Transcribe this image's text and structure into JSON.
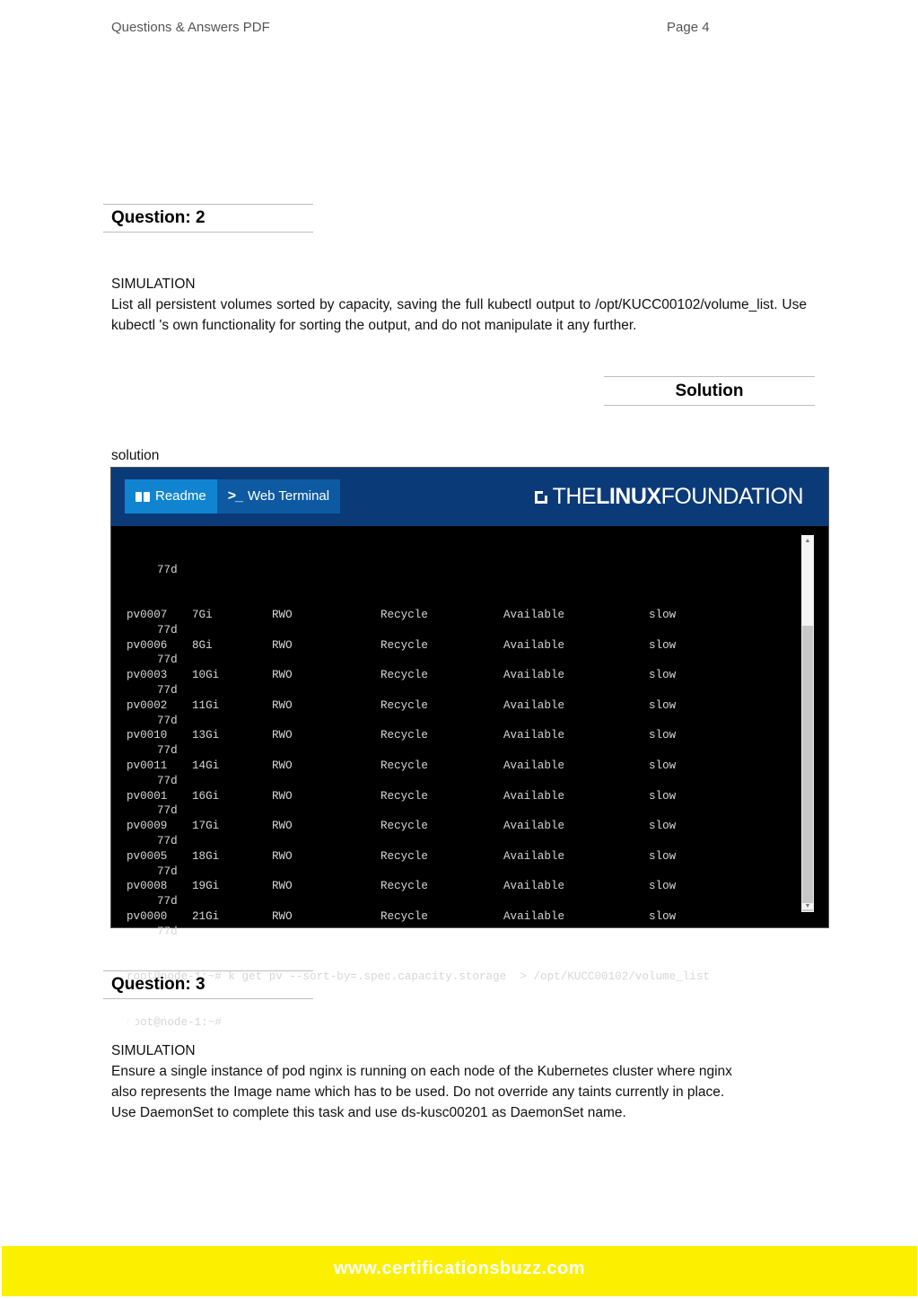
{
  "header": {
    "title": "Questions & Answers PDF",
    "page": "Page 4"
  },
  "question2": {
    "heading": "Question: 2",
    "type": "SIMULATION",
    "lines": [
      "List all persistent volumes sorted by capacity, saving the full kubectl output to",
      "/opt/KUCC00102/volume_list. Use kubectl 's own functionality for sorting the output, and do not",
      "manipulate it any further."
    ]
  },
  "solution": {
    "heading": "Solution",
    "label": "solution"
  },
  "terminal": {
    "tabs": [
      {
        "label": "Readme",
        "icon": "book-icon"
      },
      {
        "label": "Web Terminal",
        "icon": "terminal-prompt-icon"
      }
    ],
    "logo": {
      "prefix": "THE",
      "bold": "LINUX",
      "suffix": "FOUNDATION"
    },
    "first_age": "77d",
    "rows": [
      {
        "name": "pv0007",
        "capacity": "7Gi",
        "access": "RWO",
        "policy": "Recycle",
        "status": "Available",
        "class": "slow",
        "age": "77d"
      },
      {
        "name": "pv0006",
        "capacity": "8Gi",
        "access": "RWO",
        "policy": "Recycle",
        "status": "Available",
        "class": "slow",
        "age": "77d"
      },
      {
        "name": "pv0003",
        "capacity": "10Gi",
        "access": "RWO",
        "policy": "Recycle",
        "status": "Available",
        "class": "slow",
        "age": "77d"
      },
      {
        "name": "pv0002",
        "capacity": "11Gi",
        "access": "RWO",
        "policy": "Recycle",
        "status": "Available",
        "class": "slow",
        "age": "77d"
      },
      {
        "name": "pv0010",
        "capacity": "13Gi",
        "access": "RWO",
        "policy": "Recycle",
        "status": "Available",
        "class": "slow",
        "age": "77d"
      },
      {
        "name": "pv0011",
        "capacity": "14Gi",
        "access": "RWO",
        "policy": "Recycle",
        "status": "Available",
        "class": "slow",
        "age": "77d"
      },
      {
        "name": "pv0001",
        "capacity": "16Gi",
        "access": "RWO",
        "policy": "Recycle",
        "status": "Available",
        "class": "slow",
        "age": "77d"
      },
      {
        "name": "pv0009",
        "capacity": "17Gi",
        "access": "RWO",
        "policy": "Recycle",
        "status": "Available",
        "class": "slow",
        "age": "77d"
      },
      {
        "name": "pv0005",
        "capacity": "18Gi",
        "access": "RWO",
        "policy": "Recycle",
        "status": "Available",
        "class": "slow",
        "age": "77d"
      },
      {
        "name": "pv0008",
        "capacity": "19Gi",
        "access": "RWO",
        "policy": "Recycle",
        "status": "Available",
        "class": "slow",
        "age": "77d"
      },
      {
        "name": "pv0000",
        "capacity": "21Gi",
        "access": "RWO",
        "policy": "Recycle",
        "status": "Available",
        "class": "slow",
        "age": "77d"
      }
    ],
    "command_line": "root@node-1:~# k get pv --sort-by=.spec.capacity.storage  > /opt/KUCC00102/volume_list",
    "prompt_line": "root@node-1:~# "
  },
  "question3": {
    "heading": "Question: 3",
    "type": "SIMULATION",
    "lines": [
      "Ensure a single instance of pod nginx is running on each node of the Kubernetes cluster where nginx",
      "also represents the Image name which has to be used. Do not override any taints currently in place.",
      "Use DaemonSet to complete this task and use ds-kusc00201 as DaemonSet name."
    ]
  },
  "footer": {
    "url": "www.certificationsbuzz.com"
  },
  "colors": {
    "terminal_header": "#0b3a78",
    "readme_tab": "#1184d1",
    "web_terminal_tab": "#0d5aa2",
    "footer_bg": "#fdef00"
  }
}
